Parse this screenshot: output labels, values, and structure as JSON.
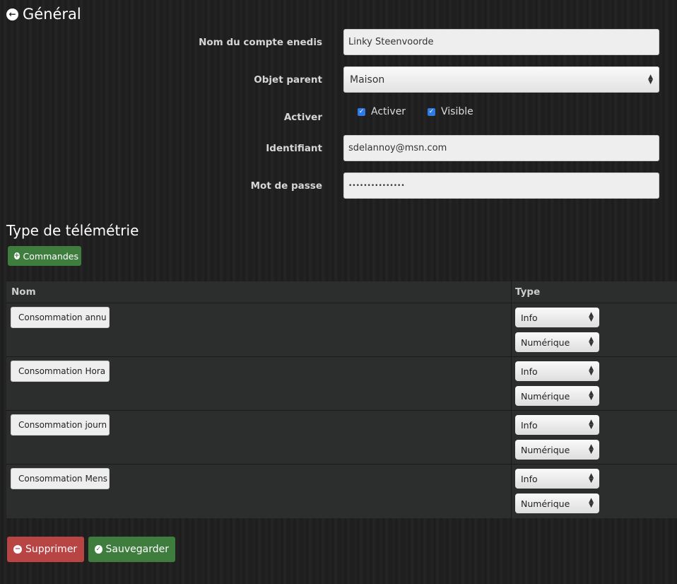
{
  "header": {
    "title": "Général",
    "back_icon": "arrow-circle-left-icon"
  },
  "form": {
    "account_name": {
      "label": "Nom du compte enedis",
      "value": "Linky Steenvoorde"
    },
    "parent": {
      "label": "Objet parent",
      "value": "Maison"
    },
    "activate": {
      "label": "Activer",
      "options": [
        {
          "label": "Activer",
          "checked": true
        },
        {
          "label": "Visible",
          "checked": true
        }
      ]
    },
    "login": {
      "label": "Identifiant",
      "value": "sdelannoy@msn.com"
    },
    "password": {
      "label": "Mot de passe",
      "value": "•••••••••••••••"
    }
  },
  "telemetry": {
    "title": "Type de télémétrie",
    "add_button": "Commandes",
    "columns": [
      "Nom",
      "Type"
    ],
    "rows": [
      {
        "name": "Consommation annu",
        "type": "Info",
        "subtype": "Numérique"
      },
      {
        "name": "Consommation Hora",
        "type": "Info",
        "subtype": "Numérique"
      },
      {
        "name": "Consommation journ",
        "type": "Info",
        "subtype": "Numérique"
      },
      {
        "name": "Consommation Mens",
        "type": "Info",
        "subtype": "Numérique"
      }
    ]
  },
  "actions": {
    "delete": "Supprimer",
    "save": "Sauvegarder"
  },
  "colors": {
    "green": "#3e7d3e",
    "red": "#b84444",
    "checkbox": "#2f7ae5"
  }
}
